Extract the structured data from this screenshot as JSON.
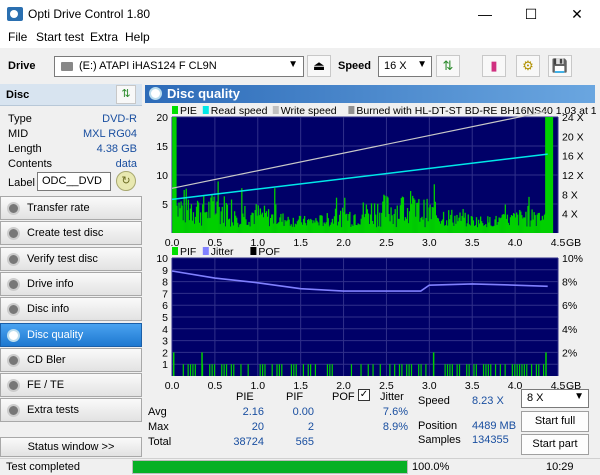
{
  "window": {
    "title": "Opti Drive Control 1.80",
    "min": "—",
    "max": "☐",
    "close": "✕"
  },
  "menu": [
    "File",
    "Start test",
    "Extra",
    "Help"
  ],
  "toolbar": {
    "drive_label": "Drive",
    "drive_value": "(E:)   ATAPI iHAS124   F CL9N",
    "speed_label": "Speed",
    "speed_value": "16 X"
  },
  "disc": {
    "header": "Disc",
    "rows": [
      {
        "k": "Type",
        "v": "DVD-R"
      },
      {
        "k": "MID",
        "v": "MXL RG04"
      },
      {
        "k": "Length",
        "v": "4.38 GB"
      },
      {
        "k": "Contents",
        "v": "data"
      }
    ],
    "label_key": "Label",
    "label_value": "ODC__DVD"
  },
  "nav": [
    "Transfer rate",
    "Create test disc",
    "Verify test disc",
    "Drive info",
    "Disc info",
    "Disc quality",
    "CD Bler",
    "FE / TE",
    "Extra tests"
  ],
  "nav_active": "Disc quality",
  "status_window": "Status window >>",
  "main": {
    "title": "Disc quality"
  },
  "chart_data": [
    {
      "type": "bar",
      "legend": [
        "PIE",
        "Read speed",
        "Write speed",
        "Burned with HL-DT-ST BD-RE  BH16NS40 1.03 at 17X"
      ],
      "colors": {
        "PIE": "#00e000",
        "Read speed": "#00e8e8",
        "Write speed": "#c0c0c0"
      },
      "x_ticks": [
        "0.0",
        "0.5",
        "1.0",
        "1.5",
        "2.0",
        "2.5",
        "3.0",
        "3.5",
        "4.0",
        "4.5"
      ],
      "x_unit": "GB",
      "y_left_ticks": [
        "20",
        "15",
        "10",
        "5"
      ],
      "y_right_ticks": [
        "24 X",
        "20 X",
        "16 X",
        "12 X",
        "8 X",
        "4 X"
      ],
      "ylim": [
        0,
        20
      ],
      "xlim": [
        0,
        4.5
      ],
      "read_speed": {
        "x": [
          0,
          4.38
        ],
        "y": [
          5.8,
          13.6
        ]
      },
      "write_speed": {
        "x": [
          0,
          4.38
        ],
        "y": [
          7.7,
          21.0
        ]
      }
    },
    {
      "type": "bar",
      "legend": [
        "PIF",
        "Jitter",
        "POF"
      ],
      "colors": {
        "PIF": "#00e000",
        "Jitter": "#8080ff",
        "POF": "#ffffff"
      },
      "x_ticks": [
        "0.0",
        "0.5",
        "1.0",
        "1.5",
        "2.0",
        "2.5",
        "3.0",
        "3.5",
        "4.0",
        "4.5"
      ],
      "x_unit": "GB",
      "y_left_ticks": [
        "10",
        "9",
        "8",
        "7",
        "6",
        "5",
        "4",
        "3",
        "2",
        "1"
      ],
      "y_right_ticks": [
        "10%",
        "8%",
        "6%",
        "4%",
        "2%"
      ],
      "ylim": [
        0,
        10
      ],
      "xlim": [
        0,
        4.5
      ],
      "jitter": {
        "x": [
          0,
          0.5,
          1.0,
          1.5,
          2.0,
          2.5,
          2.9,
          3.0,
          3.5,
          4.0,
          4.38
        ],
        "y": [
          8.9,
          8.3,
          7.9,
          7.4,
          7.2,
          7.2,
          7.2,
          7.7,
          7.8,
          7.7,
          7.6
        ]
      }
    }
  ],
  "stats": {
    "cols": [
      "PIE",
      "PIF",
      "POF",
      "Jitter"
    ],
    "rows": [
      {
        "k": "Avg",
        "v": [
          "2.16",
          "0.00",
          "",
          "7.6%"
        ]
      },
      {
        "k": "Max",
        "v": [
          "20",
          "2",
          "",
          "8.9%"
        ]
      },
      {
        "k": "Total",
        "v": [
          "38724",
          "565",
          "",
          ""
        ]
      }
    ],
    "speed_label": "Speed",
    "speed_value": "8.23 X",
    "position_label": "Position",
    "position_value": "4489 MB",
    "samples_label": "Samples",
    "samples_value": "134355",
    "speed_select": "8 X",
    "start_full": "Start full",
    "start_part": "Start part",
    "jitter_checked": "✓"
  },
  "status": {
    "text": "Test completed",
    "progress": 1.0,
    "progress_text": "100.0%",
    "time": "10:29"
  }
}
